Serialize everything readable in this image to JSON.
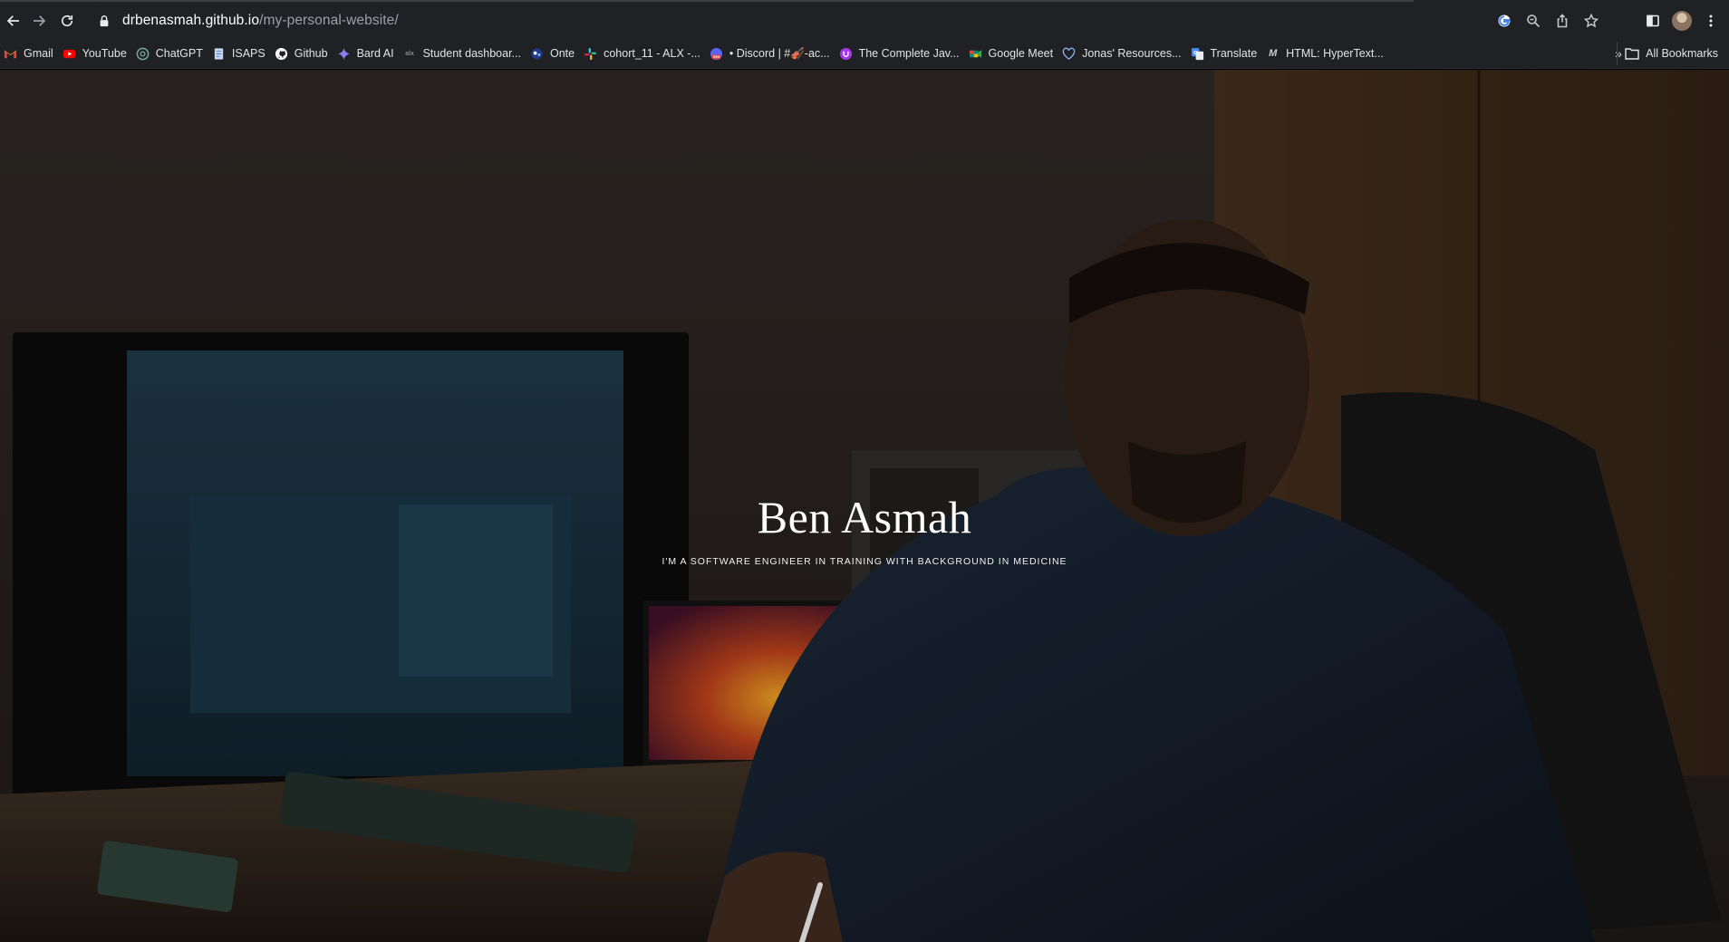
{
  "browser": {
    "url_host": "drbenasmah.github.io",
    "url_path": "/my-personal-website/",
    "nav_icons": [
      "back-icon",
      "forward-icon",
      "reload-icon"
    ],
    "omnibox_icons": [
      "google-lens-icon",
      "zoom-icon",
      "share-icon",
      "bookmark-star-icon"
    ],
    "toolbar_icons": [
      "side-panel-icon",
      "profile-avatar",
      "menu-kebab-icon"
    ]
  },
  "bookmarks": {
    "items": [
      {
        "label": "Gmail",
        "icon": "gmail-icon",
        "color": "#ea4335"
      },
      {
        "label": "YouTube",
        "icon": "youtube-icon",
        "color": "#ff0000"
      },
      {
        "label": "ChatGPT",
        "icon": "chatgpt-icon",
        "color": "#74aa9c"
      },
      {
        "label": "ISAPS",
        "icon": "document-icon",
        "color": "#8ab4f8"
      },
      {
        "label": "Github",
        "icon": "github-icon",
        "color": "#ffffff"
      },
      {
        "label": "Bard AI",
        "icon": "bard-icon",
        "color": "#8e7cf0"
      },
      {
        "label": "Student dashboar...",
        "icon": "alx-icon",
        "color": "#555555"
      },
      {
        "label": "Onte",
        "icon": "onte-icon",
        "color": "#4a6cf7"
      },
      {
        "label": "cohort_11 - ALX -...",
        "icon": "slack-icon",
        "color": "#e01e5a"
      },
      {
        "label": "• Discord | #🎻-ac...",
        "icon": "discord-icon",
        "color": "#5865f2"
      },
      {
        "label": "The Complete Jav...",
        "icon": "udemy-icon",
        "color": "#a435f0"
      },
      {
        "label": "Google Meet",
        "icon": "meet-icon",
        "color": "#00897b"
      },
      {
        "label": "Jonas' Resources...",
        "icon": "heart-icon",
        "color": "#8ab4f8"
      },
      {
        "label": "Translate",
        "icon": "translate-icon",
        "color": "#4285f4"
      },
      {
        "label": "HTML: HyperText...",
        "icon": "mdn-icon",
        "color": "#cccccc"
      }
    ],
    "more_label": "»",
    "all_label": "All Bookmarks"
  },
  "hero": {
    "name": "Ben Asmah",
    "tagline": "I'M A SOFTWARE ENGINEER IN TRAINING WITH BACKGROUND IN MEDICINE",
    "background": "photo of man seated at desk with monitor and laptop"
  }
}
